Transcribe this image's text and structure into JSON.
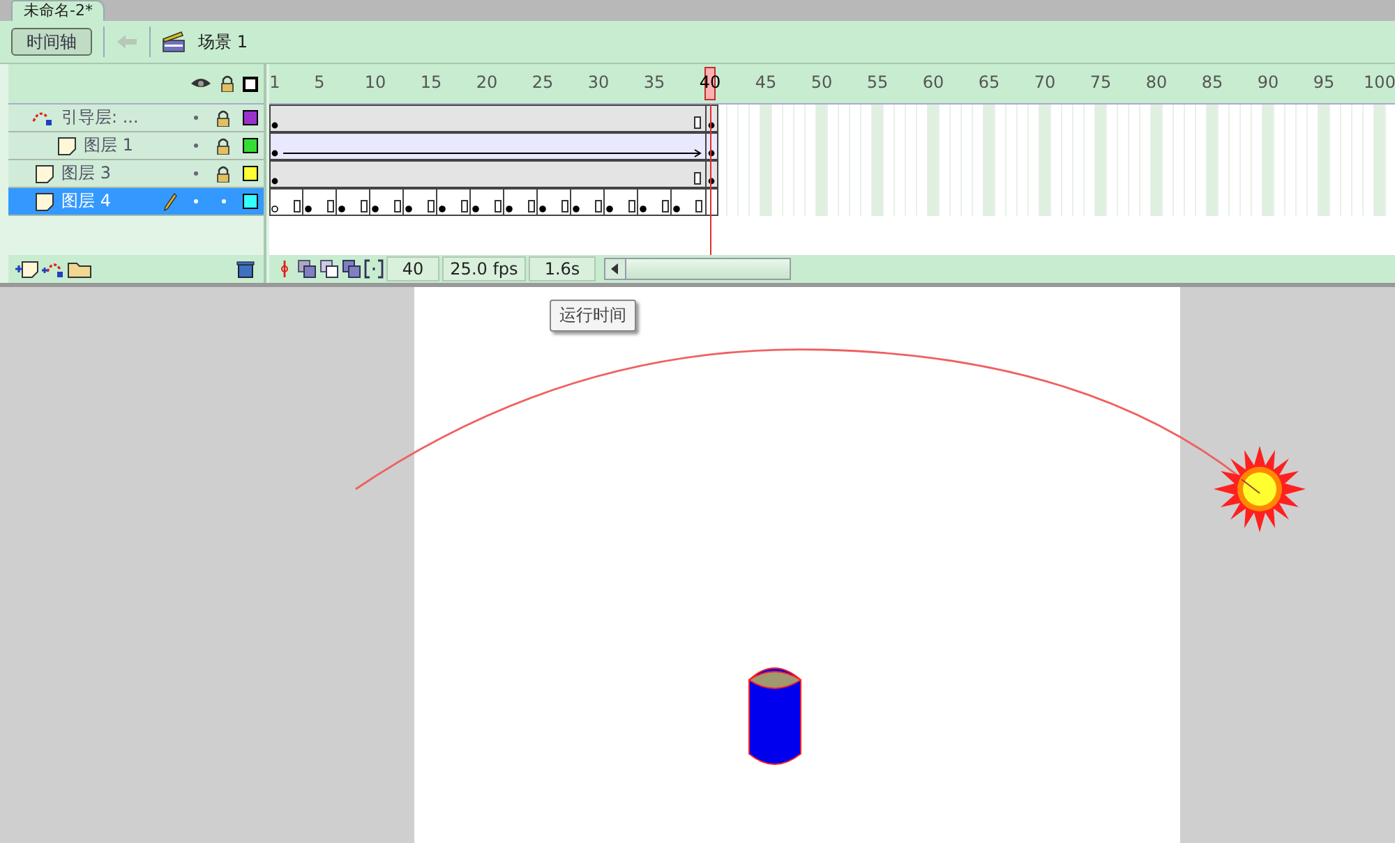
{
  "document_tab": {
    "label": "未命名-2*"
  },
  "toolbar": {
    "timeline_button": "时间轴",
    "scene": "场景 1"
  },
  "timeline": {
    "ruler": [
      {
        "label": "1",
        "selected": false
      },
      {
        "label": "5",
        "selected": false
      },
      {
        "label": "10",
        "selected": false
      },
      {
        "label": "15",
        "selected": false
      },
      {
        "label": "20",
        "selected": false
      },
      {
        "label": "25",
        "selected": false
      },
      {
        "label": "30",
        "selected": false
      },
      {
        "label": "35",
        "selected": false
      },
      {
        "label": "40",
        "selected": true
      },
      {
        "label": "45",
        "selected": false
      },
      {
        "label": "50",
        "selected": false
      },
      {
        "label": "55",
        "selected": false
      },
      {
        "label": "60",
        "selected": false
      },
      {
        "label": "65",
        "selected": false
      },
      {
        "label": "70",
        "selected": false
      },
      {
        "label": "75",
        "selected": false
      },
      {
        "label": "80",
        "selected": false
      },
      {
        "label": "85",
        "selected": false
      },
      {
        "label": "90",
        "selected": false
      },
      {
        "label": "95",
        "selected": false
      },
      {
        "label": "100",
        "selected": false
      }
    ],
    "layers": [
      {
        "name": "引导层: ...",
        "kind": "guide",
        "selected": false,
        "locked": true,
        "editing": false,
        "color": "#9933cc",
        "track": {
          "kind": "static"
        },
        "children": [
          {
            "name": "图层 1",
            "kind": "normal",
            "selected": false,
            "locked": true,
            "editing": false,
            "color": "#33dd33",
            "track": {
              "kind": "motion"
            }
          }
        ]
      },
      {
        "name": "图层 3",
        "kind": "normal",
        "selected": false,
        "locked": true,
        "editing": false,
        "color": "#ffff33",
        "track": {
          "kind": "static"
        }
      },
      {
        "name": "图层 4",
        "kind": "normal",
        "selected": true,
        "locked": false,
        "editing": true,
        "color": "#33ffff",
        "track": {
          "kind": "frames"
        }
      }
    ],
    "status": {
      "frame": "40",
      "fps": "25.0 fps",
      "time": "1.6s"
    }
  },
  "tooltip": "运行时间"
}
